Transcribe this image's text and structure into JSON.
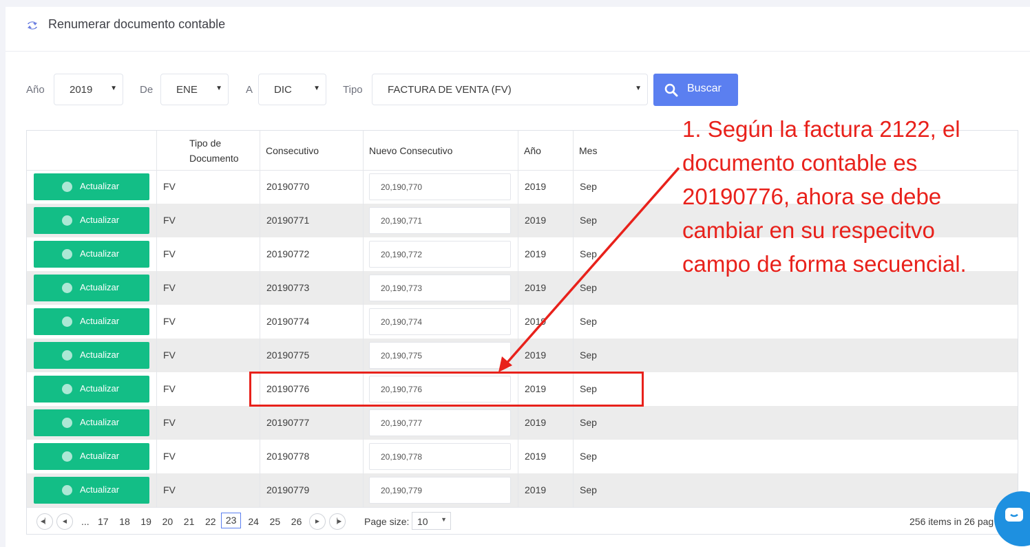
{
  "header": {
    "title": "Renumerar documento contable",
    "icon": "refresh-icon"
  },
  "filters": {
    "year_label": "Año",
    "year_value": "2019",
    "from_label": "De",
    "from_value": "ENE",
    "to_label": "A",
    "to_value": "DIC",
    "type_label": "Tipo",
    "type_value": "FACTURA DE VENTA (FV)",
    "search_label": "Buscar"
  },
  "table": {
    "columns": [
      "",
      "Tipo de Documento",
      "Consecutivo",
      "Nuevo Consecutivo",
      "Año",
      "Mes"
    ],
    "column_lines": {
      "tipo": [
        "Tipo de",
        "Documento"
      ]
    },
    "action_label": "Actualizar",
    "rows": [
      {
        "tipo": "FV",
        "consecutivo": "20190770",
        "nuevo": "20,190,770",
        "anio": "2019",
        "mes": "Sep"
      },
      {
        "tipo": "FV",
        "consecutivo": "20190771",
        "nuevo": "20,190,771",
        "anio": "2019",
        "mes": "Sep"
      },
      {
        "tipo": "FV",
        "consecutivo": "20190772",
        "nuevo": "20,190,772",
        "anio": "2019",
        "mes": "Sep"
      },
      {
        "tipo": "FV",
        "consecutivo": "20190773",
        "nuevo": "20,190,773",
        "anio": "2019",
        "mes": "Sep"
      },
      {
        "tipo": "FV",
        "consecutivo": "20190774",
        "nuevo": "20,190,774",
        "anio": "2019",
        "mes": "Sep"
      },
      {
        "tipo": "FV",
        "consecutivo": "20190775",
        "nuevo": "20,190,775",
        "anio": "2019",
        "mes": "Sep"
      },
      {
        "tipo": "FV",
        "consecutivo": "20190776",
        "nuevo": "20,190,776",
        "anio": "2019",
        "mes": "Sep"
      },
      {
        "tipo": "FV",
        "consecutivo": "20190777",
        "nuevo": "20,190,777",
        "anio": "2019",
        "mes": "Sep"
      },
      {
        "tipo": "FV",
        "consecutivo": "20190778",
        "nuevo": "20,190,778",
        "anio": "2019",
        "mes": "Sep"
      },
      {
        "tipo": "FV",
        "consecutivo": "20190779",
        "nuevo": "20,190,779",
        "anio": "2019",
        "mes": "Sep"
      }
    ]
  },
  "pager": {
    "ellipsis": "...",
    "pages": [
      "17",
      "18",
      "19",
      "20",
      "21",
      "22",
      "23",
      "24",
      "25",
      "26"
    ],
    "current": "23",
    "page_size_label": "Page size:",
    "page_size": "10",
    "total_items": "256",
    "items_in": "items in",
    "total_pages": "26",
    "pages_suffix": "pag"
  },
  "annotation": {
    "lines": [
      "1. Según la factura 2122, el",
      "documento contable es",
      "20190776, ahora se debe",
      "cambiar en su respecitvo",
      "campo de forma secuencial."
    ],
    "color": "#e8211b"
  },
  "colors": {
    "accent": "#5b7ff0",
    "success": "#13be86",
    "annotation": "#e8211b",
    "chat": "#1e90e0"
  }
}
